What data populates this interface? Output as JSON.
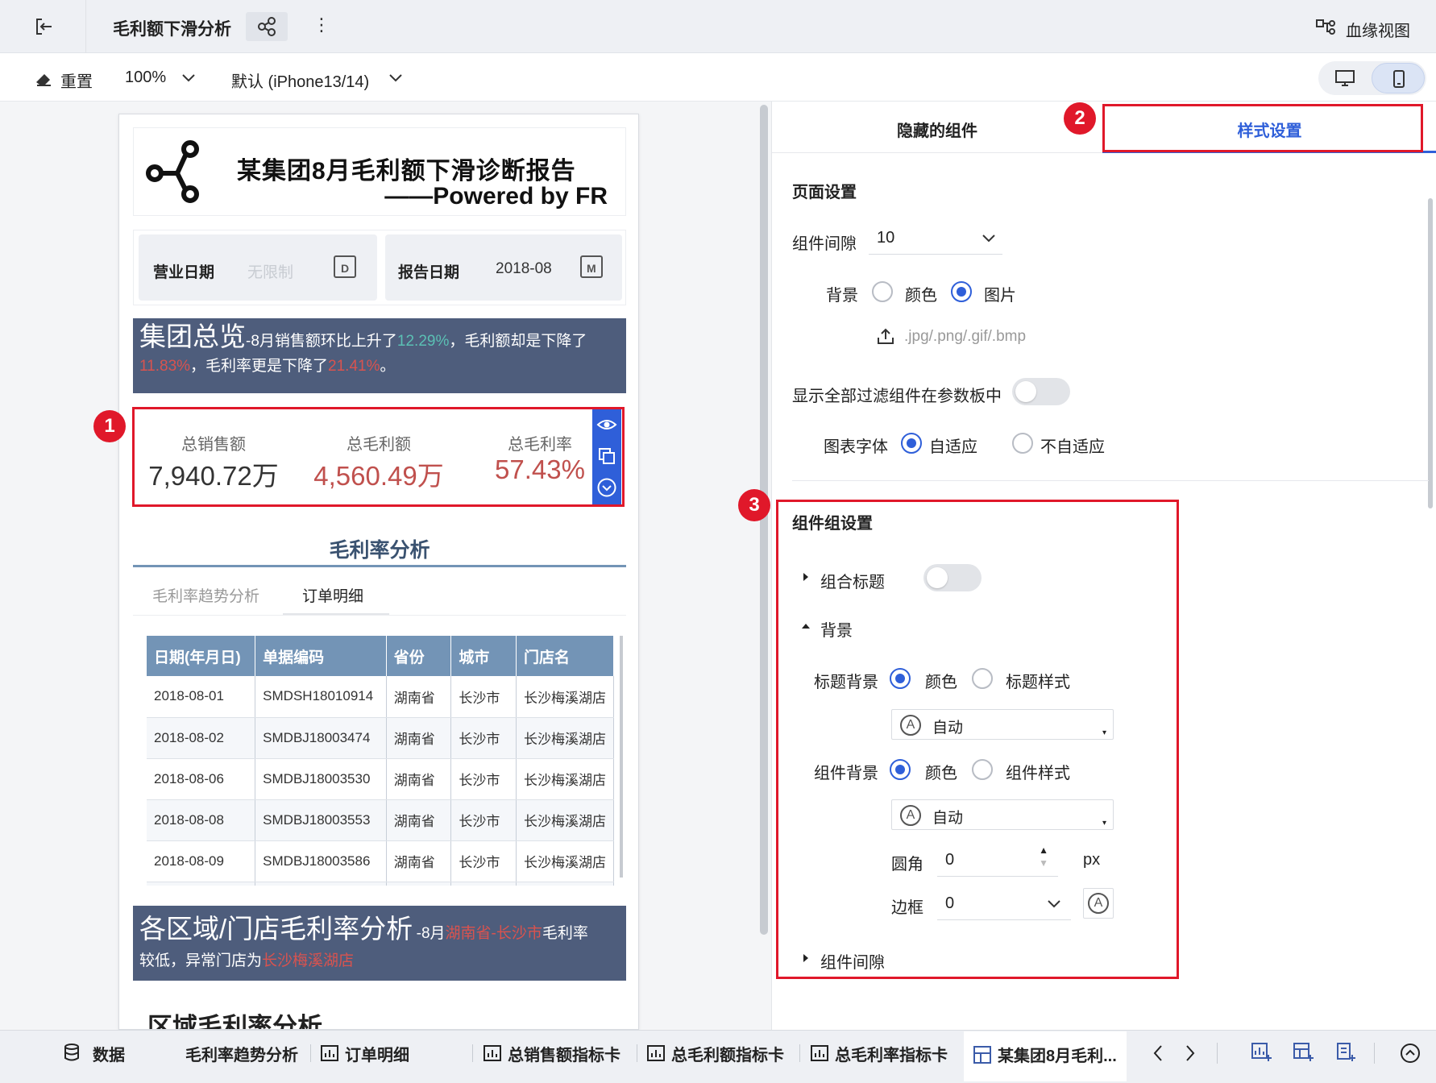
{
  "topbar": {
    "title": "毛利额下滑分析",
    "lineage_label": "血缘视图"
  },
  "toolbar": {
    "reset_label": "重置",
    "zoom": "100%",
    "device": "默认 (iPhone13/14)"
  },
  "report": {
    "title_line1": "某集团8月毛利额下滑诊断报告",
    "title_line2": "——Powered by FR",
    "filters": [
      {
        "label": "营业日期",
        "value": "无限制",
        "icon_letter": "D"
      },
      {
        "label": "报告日期",
        "value": "2018-08",
        "icon_letter": "M"
      }
    ],
    "overview": {
      "heading": "集团总览",
      "text_a": "-8月销售额环比上升了",
      "pct_a": "12.29%",
      "text_b": "，毛利额却是下降了",
      "pct_b": "11.83%",
      "text_c": "，毛利率更是下降了",
      "pct_c": "21.41%",
      "text_d": "。"
    },
    "kpis": [
      {
        "label": "总销售额",
        "value": "7,940.72万"
      },
      {
        "label": "总毛利额",
        "value": "4,560.49万"
      },
      {
        "label": "总毛利率",
        "value": "57.43%"
      }
    ],
    "margin_section": {
      "title": "毛利率分析",
      "tabs": [
        "毛利率趋势分析",
        "订单明细"
      ]
    },
    "table": {
      "columns": [
        "日期(年月日)",
        "单据编码",
        "省份",
        "城市",
        "门店名"
      ],
      "rows": [
        [
          "2018-08-01",
          "SMDSH18010914",
          "湖南省",
          "长沙市",
          "长沙梅溪湖店"
        ],
        [
          "2018-08-02",
          "SMDBJ18003474",
          "湖南省",
          "长沙市",
          "长沙梅溪湖店"
        ],
        [
          "2018-08-06",
          "SMDBJ18003530",
          "湖南省",
          "长沙市",
          "长沙梅溪湖店"
        ],
        [
          "2018-08-08",
          "SMDBJ18003553",
          "湖南省",
          "长沙市",
          "长沙梅溪湖店"
        ],
        [
          "2018-08-09",
          "SMDBJ18003586",
          "湖南省",
          "长沙市",
          "长沙梅溪湖店"
        ]
      ]
    },
    "region_banner": {
      "heading": "各区域/门店毛利率分析",
      "text_a": "-8月",
      "hl_a": "湖南省-长沙市",
      "text_b": "毛利率",
      "text_c": "较低，异常门店为",
      "hl_b": "长沙梅溪湖店"
    },
    "region_title": "区域毛利率分析"
  },
  "badges": [
    "1",
    "2",
    "3"
  ],
  "panel": {
    "tabs": [
      "隐藏的组件",
      "样式设置"
    ],
    "page_settings": {
      "title": "页面设置",
      "gap_label": "组件间隙",
      "gap_value": "10",
      "bg_label": "背景",
      "bg_opt_color": "颜色",
      "bg_opt_image": "图片",
      "upload_hint": ".jpg/.png/.gif/.bmp",
      "show_filters_label": "显示全部过滤组件在参数板中",
      "font_label": "图表字体",
      "font_opt_adaptive": "自适应",
      "font_opt_fixed": "不自适应"
    },
    "group_settings": {
      "title": "组件组设置",
      "group_title_label": "组合标题",
      "bg_section": "背景",
      "title_bg_label": "标题背景",
      "title_bg_opt_color": "颜色",
      "title_bg_opt_style": "标题样式",
      "title_bg_value": "自动",
      "comp_bg_label": "组件背景",
      "comp_bg_opt_color": "颜色",
      "comp_bg_opt_style": "组件样式",
      "comp_bg_value": "自动",
      "radius_label": "圆角",
      "radius_value": "0",
      "radius_unit": "px",
      "border_label": "边框",
      "border_value": "0",
      "gap_section": "组件间隙"
    }
  },
  "bottom_tabs": {
    "data": "数据",
    "items": [
      "毛利率趋势分析",
      "订单明细",
      "总销售额指标卡",
      "总毛利额指标卡",
      "总毛利率指标卡",
      "某集团8月毛利..."
    ]
  },
  "colors": {
    "accent": "#2f5fd9",
    "banner": "#4e5d7c",
    "kpi_red": "#c0504d",
    "highlight_green": "#5bc0b4",
    "highlight_red": "#d9534f",
    "annotation": "#e0182a",
    "table_header": "#7394b6"
  },
  "icons": [
    "exit-icon",
    "share-icon",
    "more-icon",
    "lineage-icon",
    "reset-icon",
    "chevron-down-icon",
    "desktop-icon",
    "mobile-icon",
    "logo-icon",
    "calendar-icon",
    "eye-icon",
    "copy-icon",
    "collapse-icon",
    "upload-icon",
    "caret-right-icon",
    "caret-down-icon",
    "color-auto-icon",
    "database-icon",
    "chart-tab-icon",
    "dashboard-tab-icon",
    "prev-icon",
    "next-icon",
    "add-chart-icon",
    "add-dashboard-icon",
    "add-report-icon",
    "scroll-up-icon"
  ]
}
